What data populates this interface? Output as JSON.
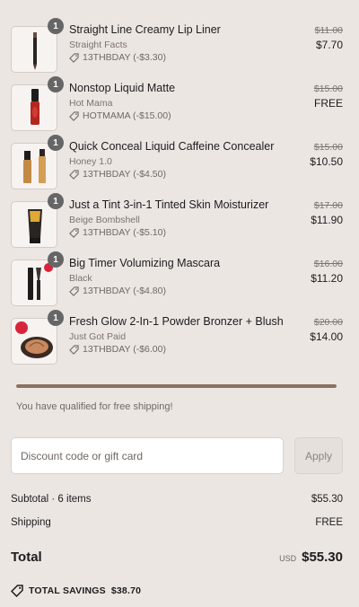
{
  "items": [
    {
      "qty": "1",
      "name": "Straight Line Creamy Lip Liner",
      "variant": "Straight Facts",
      "discount": "13THBDAY (-$3.30)",
      "original_price": "$11.00",
      "price": "$7.70",
      "icon": "lip-liner"
    },
    {
      "qty": "1",
      "name": "Nonstop Liquid Matte",
      "variant": "Hot Mama",
      "discount": "HOTMAMA (-$15.00)",
      "original_price": "$15.00",
      "price": "FREE",
      "icon": "liquid-lipstick"
    },
    {
      "qty": "1",
      "name": "Quick Conceal Liquid Caffeine Concealer",
      "variant": "Honey 1.0",
      "discount": "13THBDAY (-$4.50)",
      "original_price": "$15.00",
      "price": "$10.50",
      "icon": "concealer"
    },
    {
      "qty": "1",
      "name": "Just a Tint 3-in-1 Tinted Skin Moisturizer",
      "variant": "Beige Bombshell",
      "discount": "13THBDAY (-$5.10)",
      "original_price": "$17.00",
      "price": "$11.90",
      "icon": "tinted-moisturizer"
    },
    {
      "qty": "1",
      "name": "Big Timer Volumizing Mascara",
      "variant": "Black",
      "discount": "13THBDAY (-$4.80)",
      "original_price": "$16.00",
      "price": "$11.20",
      "icon": "mascara"
    },
    {
      "qty": "1",
      "name": "Fresh Glow 2-In-1 Powder Bronzer + Blush",
      "variant": "Just Got Paid",
      "discount": "13THBDAY (-$6.00)",
      "original_price": "$20.00",
      "price": "$14.00",
      "icon": "bronzer-compact"
    }
  ],
  "shipping_progress": 1.0,
  "shipping_message": "You have qualified for free shipping!",
  "discount_field": {
    "placeholder": "Discount code or gift card",
    "value": ""
  },
  "apply_label": "Apply",
  "summary": {
    "subtotal_label": "Subtotal · 6 items",
    "subtotal_value": "$55.30",
    "shipping_label": "Shipping",
    "shipping_value": "FREE",
    "total_label": "Total",
    "currency": "USD",
    "total_value": "$55.30",
    "savings_label": "TOTAL SAVINGS",
    "savings_value": "$38.70"
  },
  "colors": {
    "background": "#ece6e3",
    "progress": "#8b7160",
    "badge": "#666666"
  }
}
